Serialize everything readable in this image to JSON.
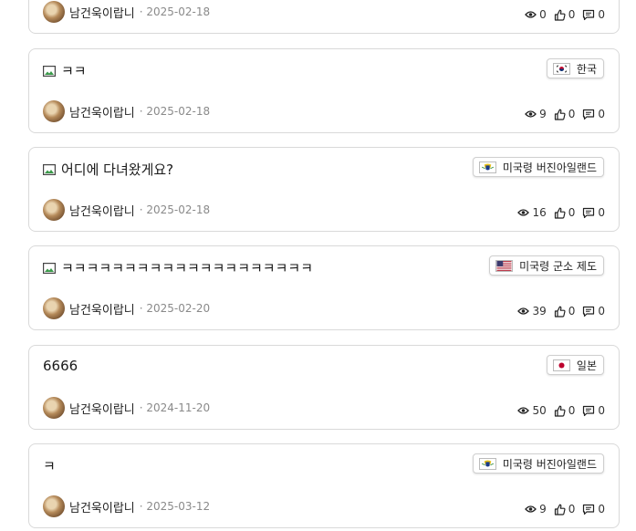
{
  "posts": [
    {
      "title": "",
      "has_image_icon": false,
      "country": "",
      "flag": "",
      "author": "남건욱이랍니",
      "date": "· 2025-02-18",
      "views": "0",
      "likes": "0",
      "comments": "0"
    },
    {
      "title": "ㅋㅋ",
      "has_image_icon": true,
      "country": "한국",
      "flag": "kr",
      "author": "남건욱이랍니",
      "date": "· 2025-02-18",
      "views": "9",
      "likes": "0",
      "comments": "0"
    },
    {
      "title": "어디에 다녀왔게요?",
      "has_image_icon": true,
      "country": "미국령 버진아일랜드",
      "flag": "vi",
      "author": "남건욱이랍니",
      "date": "· 2025-02-18",
      "views": "16",
      "likes": "0",
      "comments": "0"
    },
    {
      "title": "ㅋㅋㅋㅋㅋㅋㅋㅋㅋㅋㅋㅋㅋㅋㅋㅋㅋㅋㅋㅋ",
      "has_image_icon": true,
      "country": "미국령 군소 제도",
      "flag": "us",
      "author": "남건욱이랍니",
      "date": "· 2025-02-20",
      "views": "39",
      "likes": "0",
      "comments": "0"
    },
    {
      "title": "6666",
      "has_image_icon": false,
      "country": "일본",
      "flag": "jp",
      "author": "남건욱이랍니",
      "date": "· 2024-11-20",
      "views": "50",
      "likes": "0",
      "comments": "0"
    },
    {
      "title": "ㅋ",
      "has_image_icon": false,
      "country": "미국령 버진아일랜드",
      "flag": "vi",
      "author": "남건욱이랍니",
      "date": "· 2025-03-12",
      "views": "9",
      "likes": "0",
      "comments": "0"
    }
  ]
}
